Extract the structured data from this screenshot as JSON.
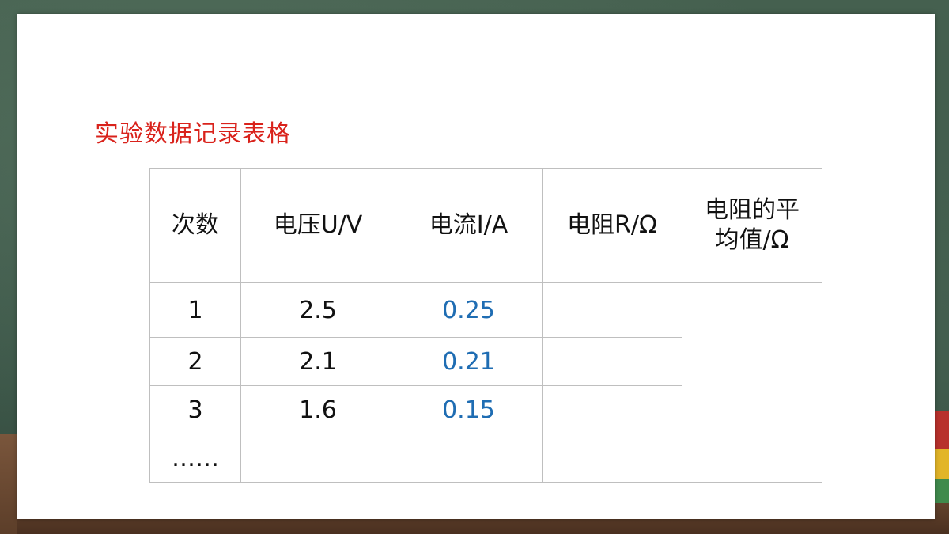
{
  "slide": {
    "title": "实验数据记录表格"
  },
  "table": {
    "headers": [
      "次数",
      "电压U/V",
      "电流I/A",
      "电阻R/Ω",
      "电阻的平均值/Ω"
    ],
    "rows": [
      {
        "trial": "1",
        "voltage": "2.5",
        "current": "0.25",
        "resistance": ""
      },
      {
        "trial": "2",
        "voltage": "2.1",
        "current": "0.21",
        "resistance": ""
      },
      {
        "trial": "3",
        "voltage": "1.6",
        "current": "0.15",
        "resistance": ""
      },
      {
        "trial": "……",
        "voltage": "",
        "current": "",
        "resistance": ""
      }
    ],
    "average_resistance": ""
  },
  "colors": {
    "title": "#d9221b",
    "current_values": "#1f6db3",
    "grid": "#bfbfbf"
  }
}
